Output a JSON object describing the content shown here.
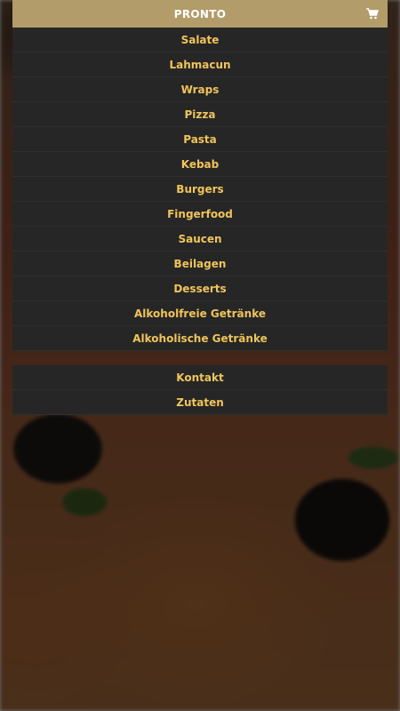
{
  "header": {
    "title": "PRONTO",
    "cart_icon": "cart-icon"
  },
  "menu": {
    "items": [
      {
        "label": "Salate"
      },
      {
        "label": "Lahmacun"
      },
      {
        "label": "Wraps"
      },
      {
        "label": "Pizza"
      },
      {
        "label": "Pasta"
      },
      {
        "label": "Kebab"
      },
      {
        "label": "Burgers"
      },
      {
        "label": "Fingerfood"
      },
      {
        "label": "Saucen"
      },
      {
        "label": "Beilagen"
      },
      {
        "label": "Desserts"
      },
      {
        "label": "Alkoholfreie Getränke"
      },
      {
        "label": "Alkoholische Getränke"
      }
    ],
    "secondary": [
      {
        "label": "Kontakt"
      },
      {
        "label": "Zutaten"
      }
    ]
  },
  "colors": {
    "header_bg": "#b19c6a",
    "item_bg": "#262626",
    "item_text": "#f0c45a"
  }
}
